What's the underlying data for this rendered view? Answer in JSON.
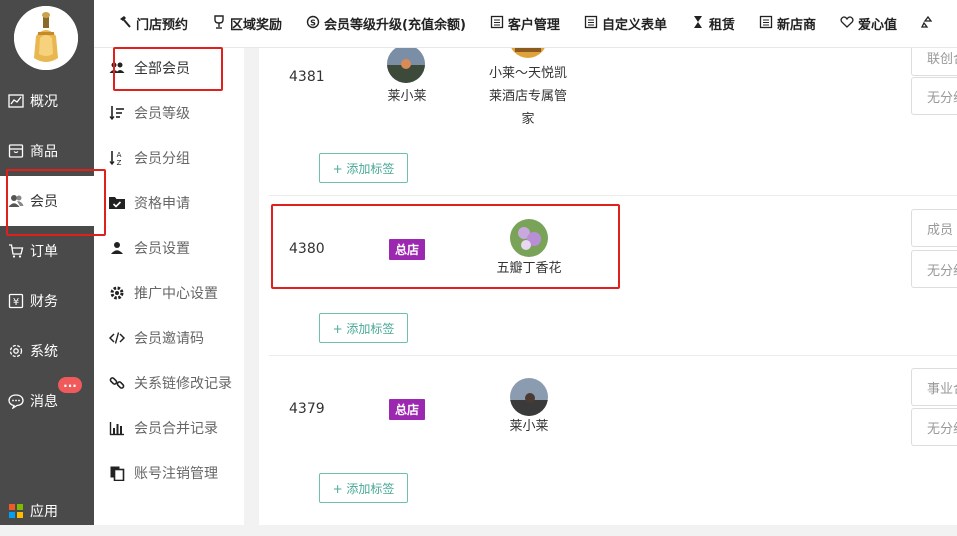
{
  "left_nav": {
    "items": [
      {
        "label": "概况",
        "icon": "chart-icon"
      },
      {
        "label": "商品",
        "icon": "box-icon"
      },
      {
        "label": "会员",
        "icon": "users-icon",
        "active": true
      },
      {
        "label": "订单",
        "icon": "cart-icon"
      },
      {
        "label": "财务",
        "icon": "yen-icon"
      },
      {
        "label": "系统",
        "icon": "gear-icon"
      },
      {
        "label": "消息",
        "icon": "chat-icon"
      },
      {
        "label": "应用",
        "icon": "apps-icon"
      }
    ],
    "message_badge": "..."
  },
  "top_nav": {
    "items": [
      {
        "label": "门店预约",
        "icon": "hammer-icon"
      },
      {
        "label": "区域奖励",
        "icon": "trophy-icon"
      },
      {
        "label": "会员等级升级(充值余额)",
        "icon": "skype-icon"
      },
      {
        "label": "客户管理",
        "icon": "form-icon"
      },
      {
        "label": "自定义表单",
        "icon": "form-icon"
      },
      {
        "label": "租赁",
        "icon": "hourglass-icon"
      },
      {
        "label": "新店商",
        "icon": "form-icon"
      },
      {
        "label": "爱心值",
        "icon": "heart-icon"
      }
    ]
  },
  "sub_nav": {
    "items": [
      {
        "label": "全部会员",
        "icon": "users-icon",
        "active": true
      },
      {
        "label": "会员等级",
        "icon": "sort-icon"
      },
      {
        "label": "会员分组",
        "icon": "sort-alpha-icon"
      },
      {
        "label": "资格申请",
        "icon": "folder-check-icon"
      },
      {
        "label": "会员设置",
        "icon": "user-icon"
      },
      {
        "label": "推广中心设置",
        "icon": "gear-icon"
      },
      {
        "label": "会员邀请码",
        "icon": "code-icon"
      },
      {
        "label": "关系链修改记录",
        "icon": "link-icon"
      },
      {
        "label": "会员合并记录",
        "icon": "bar-chart-icon"
      },
      {
        "label": "账号注销管理",
        "icon": "copy-icon"
      }
    ]
  },
  "members": [
    {
      "id": "4381",
      "store_tag": "",
      "nickname": "莱小莱",
      "referrer": "小莱～天悦凯莱酒店专属管家",
      "referrer_lines": [
        "小莱～天悦凯",
        "莱酒店专属管",
        "家"
      ],
      "group_option_1": "联创合",
      "group_option_2": "无分组",
      "add_tag_label": "+ 添加标签"
    },
    {
      "id": "4380",
      "store_tag": "总店",
      "nickname": "五瓣丁香花",
      "referrer": "",
      "group_option_1": "成员",
      "group_option_2": "无分组",
      "add_tag_label": "+ 添加标签"
    },
    {
      "id": "4379",
      "store_tag": "总店",
      "nickname": "莱小莱",
      "referrer": "",
      "group_option_1": "事业合",
      "group_option_2": "无分组",
      "add_tag_label": "+ 添加标签"
    }
  ],
  "colors": {
    "sidebar_bg": "#4a4a4a",
    "store_tag": "#9c27b0",
    "tag_button": "#4aa897",
    "highlight": "#e0201c",
    "badge": "#f05a5a"
  }
}
